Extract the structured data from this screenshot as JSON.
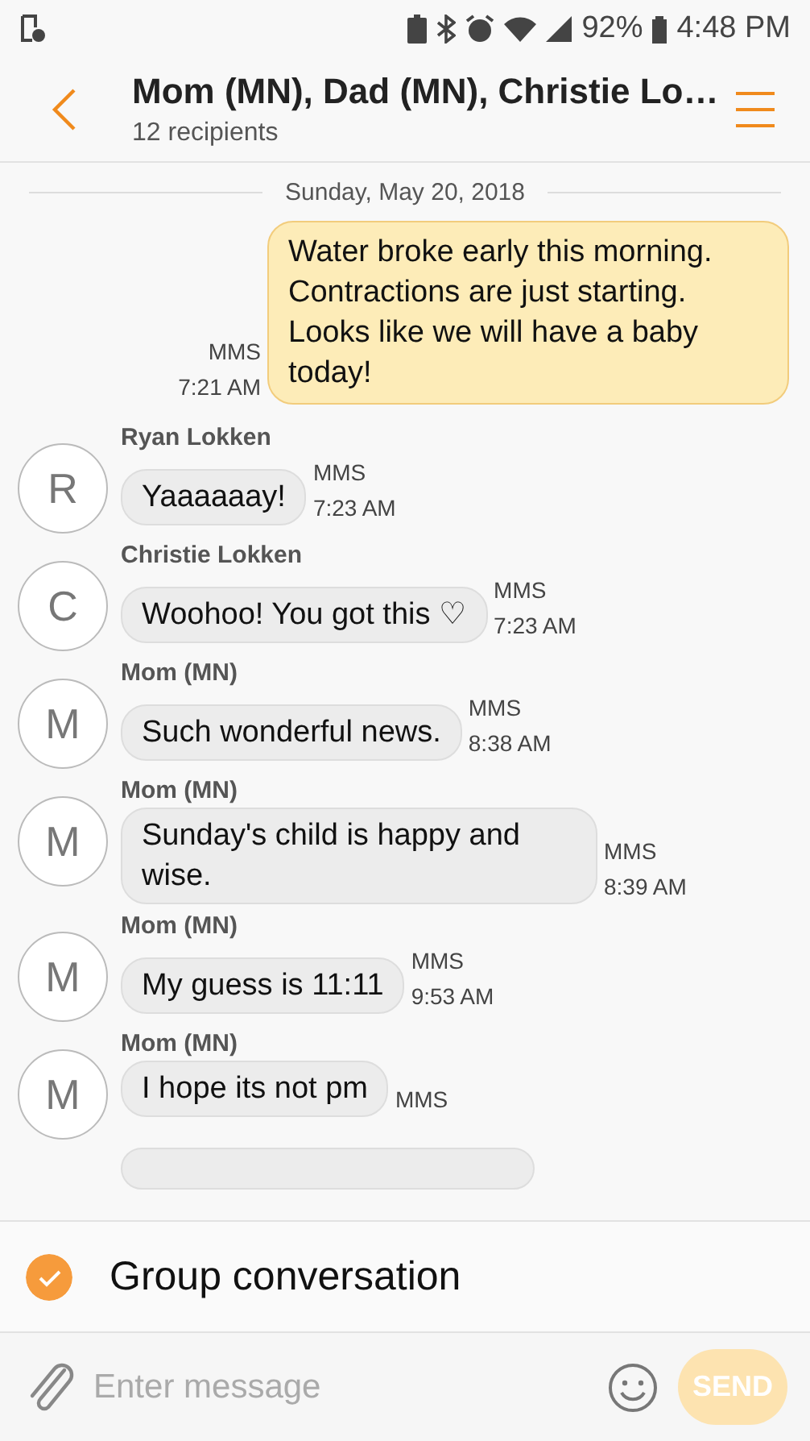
{
  "status_bar": {
    "battery": "92%",
    "time": "4:48 PM"
  },
  "header": {
    "title": "Mom (MN), Dad (MN), Christie Lo…",
    "subtitle": "12 recipients"
  },
  "date_divider": "Sunday, May 20, 2018",
  "messages": [
    {
      "kind": "sent",
      "text": "Water broke early this morning. Contractions are just starting. Looks like we will have a baby today!",
      "type": "MMS",
      "time": "7:21 AM"
    },
    {
      "kind": "received",
      "sender": "Ryan Lokken",
      "initial": "R",
      "text": "Yaaaaaay!",
      "type": "MMS",
      "time": "7:23 AM"
    },
    {
      "kind": "received",
      "sender": "Christie Lokken",
      "initial": "C",
      "text": "Woohoo! You got this ♡",
      "type": "MMS",
      "time": "7:23 AM"
    },
    {
      "kind": "received",
      "sender": "Mom (MN)",
      "initial": "M",
      "text": "Such wonderful news.",
      "type": "MMS",
      "time": "8:38 AM"
    },
    {
      "kind": "received",
      "sender": "Mom (MN)",
      "initial": "M",
      "text": "Sunday's child is happy and wise.",
      "type": "MMS",
      "time": "8:39 AM"
    },
    {
      "kind": "received",
      "sender": "Mom (MN)",
      "initial": "M",
      "text": "My guess is 11:11",
      "type": "MMS",
      "time": "9:53 AM"
    },
    {
      "kind": "received",
      "sender": "Mom (MN)",
      "initial": "M",
      "text": "I hope its not pm",
      "type": "MMS"
    },
    {
      "kind": "partial"
    }
  ],
  "group_conversation": {
    "label": "Group conversation",
    "checked": true
  },
  "composer": {
    "placeholder": "Enter message",
    "send": "SEND",
    "disabled": true
  }
}
